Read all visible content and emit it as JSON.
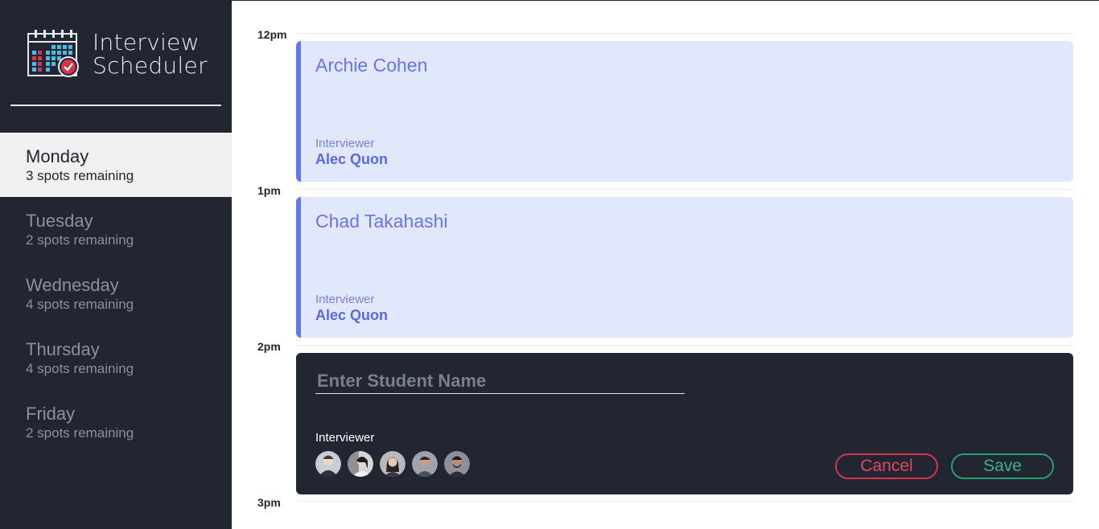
{
  "brand": {
    "title_line1": "Interview",
    "title_line2": "Scheduler",
    "logo_icon": "calendar-check-icon"
  },
  "days": [
    {
      "name": "Monday",
      "spots": "3 spots remaining",
      "selected": true
    },
    {
      "name": "Tuesday",
      "spots": "2 spots remaining",
      "selected": false
    },
    {
      "name": "Wednesday",
      "spots": "4 spots remaining",
      "selected": false
    },
    {
      "name": "Thursday",
      "spots": "4 spots remaining",
      "selected": false
    },
    {
      "name": "Friday",
      "spots": "2 spots remaining",
      "selected": false
    }
  ],
  "hours": [
    "12pm",
    "1pm",
    "2pm",
    "3pm"
  ],
  "appointments": [
    {
      "student": "Archie Cohen",
      "interviewer_label": "Interviewer",
      "interviewer": "Alec Quon"
    },
    {
      "student": "Chad Takahashi",
      "interviewer_label": "Interviewer",
      "interviewer": "Alec Quon"
    }
  ],
  "form": {
    "placeholder": "Enter Student Name",
    "value": "",
    "interviewer_label": "Interviewer",
    "avatars": [
      "interviewer-avatar-1",
      "interviewer-avatar-2",
      "interviewer-avatar-3",
      "interviewer-avatar-4",
      "interviewer-avatar-5"
    ],
    "cancel_label": "Cancel",
    "save_label": "Save"
  },
  "colors": {
    "sidebar_bg": "#222633",
    "selected_day_bg": "#f0f0f0",
    "appointment_bg": "#e2e8fb",
    "accent": "#6674f2",
    "danger": "#d7334a",
    "success": "#2a9c70"
  }
}
